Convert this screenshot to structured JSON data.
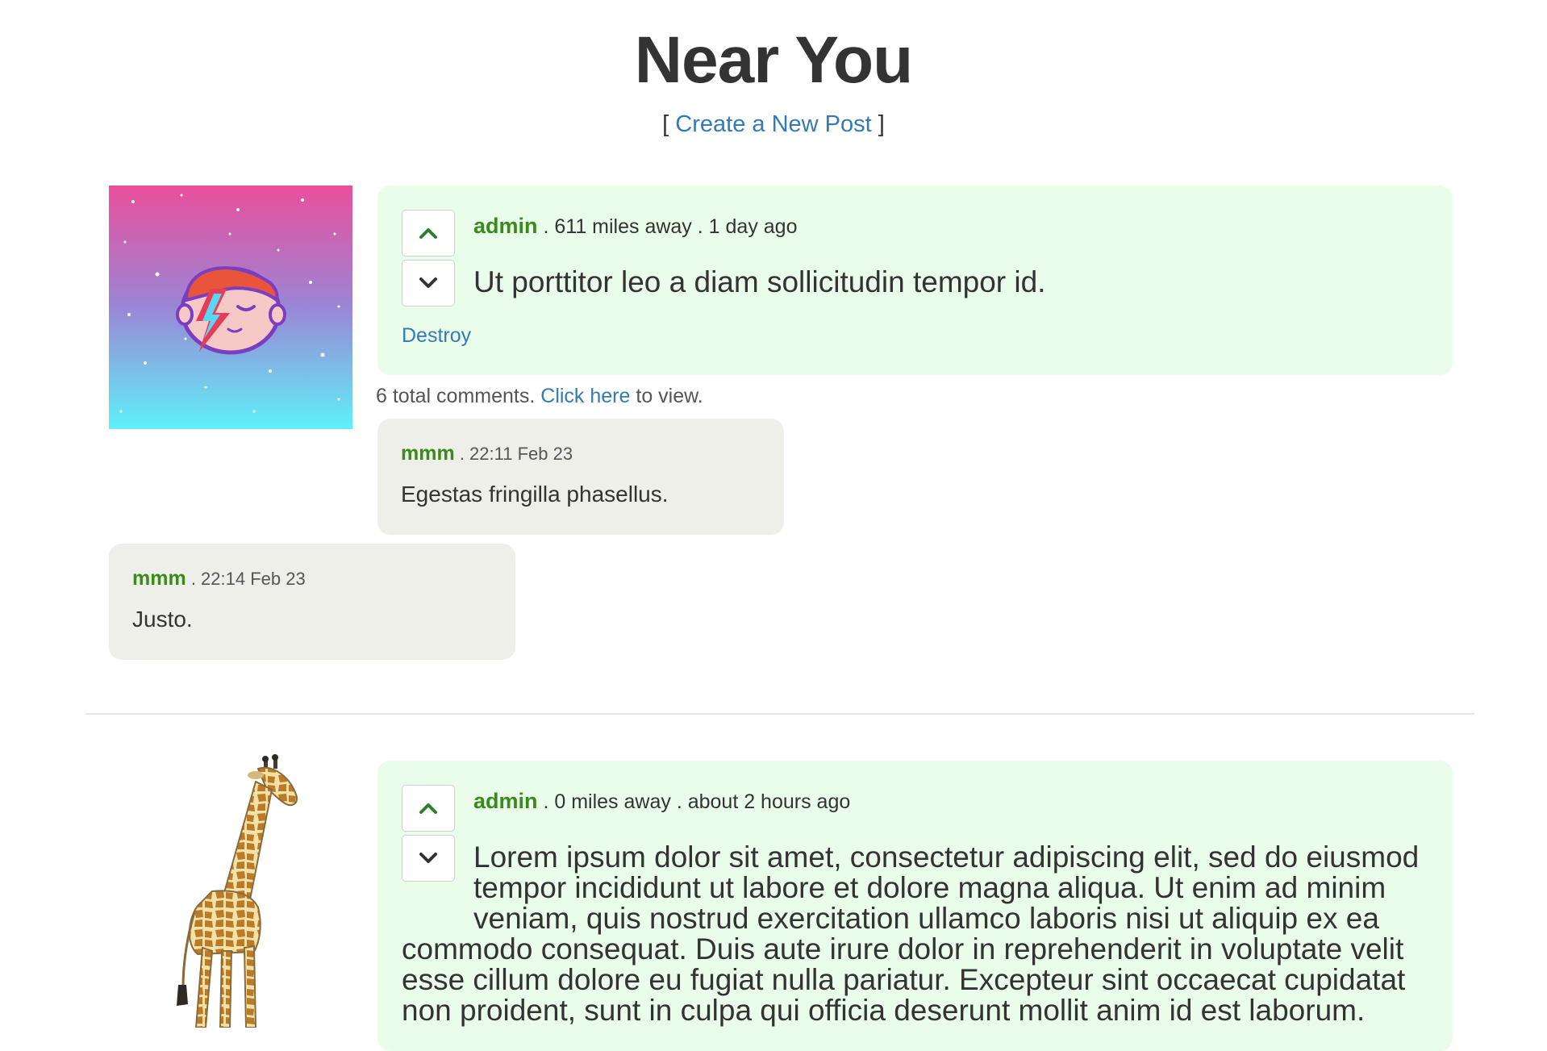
{
  "page": {
    "title": "Near You",
    "create_prefix": "[",
    "create_link": "Create a New Post",
    "create_suffix": "]"
  },
  "posts": [
    {
      "image_icon": "avatar-lightning-face-image",
      "author": "admin",
      "distance": ". 611 miles away",
      "time": ". 1 day ago",
      "body": "Ut porttitor leo a diam sollicitudin tempor id.",
      "destroy_label": "Destroy",
      "upvote_icon": "chevron-up-icon",
      "downvote_icon": "chevron-down-icon",
      "comments_prefix": "6 total comments.",
      "comments_link": "Click here",
      "comments_suffix": "to view.",
      "comments": [
        {
          "author": "mmm",
          "time": ". 22:11 Feb 23",
          "text": "Egestas fringilla phasellus."
        },
        {
          "author": "mmm",
          "time": ". 22:14 Feb 23",
          "text": "Justo."
        }
      ]
    },
    {
      "image_icon": "giraffe-image",
      "author": "admin",
      "distance": ". 0 miles away",
      "time": ". about 2 hours ago",
      "body": "Lorem ipsum dolor sit amet, consectetur adipiscing elit, sed do eiusmod tempor incididunt ut labore et dolore magna aliqua. Ut enim ad minim veniam, quis nostrud exercitation ullamco laboris nisi ut aliquip ex ea commodo consequat. Duis aute irure dolor in reprehenderit in voluptate velit esse cillum dolore eu fugiat nulla pariatur. Excepteur sint occaecat cupidatat non proident, sunt in culpa qui officia deserunt mollit anim id est laborum.",
      "upvote_icon": "chevron-up-icon",
      "downvote_icon": "chevron-down-icon"
    }
  ],
  "colors": {
    "post_bg": "#eafdea",
    "comment_bg": "#efefe9",
    "author": "#3a8a1c",
    "link": "#337ab7"
  }
}
